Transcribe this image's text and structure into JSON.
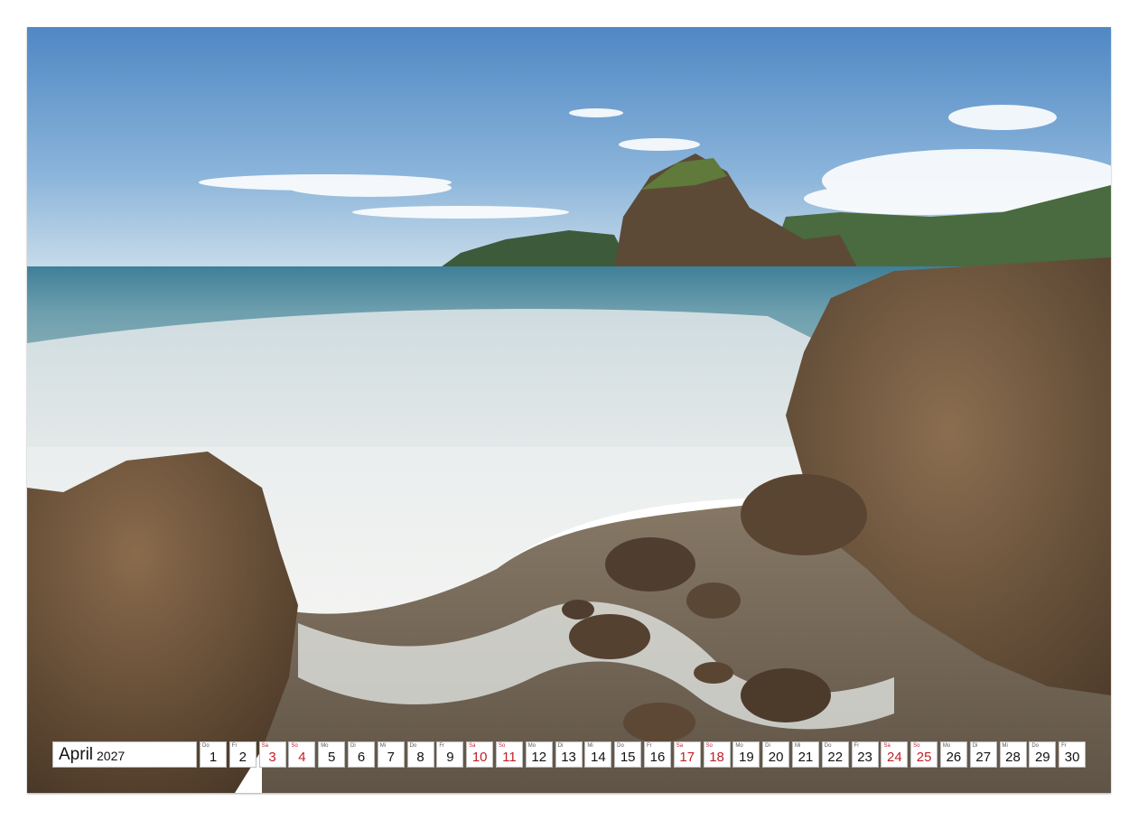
{
  "calendar": {
    "month": "April",
    "year": "2027",
    "weekend_color": "#c0202a",
    "days": [
      {
        "wd": "Do",
        "d": "1",
        "weekend": false
      },
      {
        "wd": "Fr",
        "d": "2",
        "weekend": false
      },
      {
        "wd": "Sa",
        "d": "3",
        "weekend": true
      },
      {
        "wd": "So",
        "d": "4",
        "weekend": true
      },
      {
        "wd": "Mo",
        "d": "5",
        "weekend": false
      },
      {
        "wd": "Di",
        "d": "6",
        "weekend": false
      },
      {
        "wd": "Mi",
        "d": "7",
        "weekend": false
      },
      {
        "wd": "Do",
        "d": "8",
        "weekend": false
      },
      {
        "wd": "Fr",
        "d": "9",
        "weekend": false
      },
      {
        "wd": "Sa",
        "d": "10",
        "weekend": true
      },
      {
        "wd": "So",
        "d": "11",
        "weekend": true
      },
      {
        "wd": "Mo",
        "d": "12",
        "weekend": false
      },
      {
        "wd": "Di",
        "d": "13",
        "weekend": false
      },
      {
        "wd": "Mi",
        "d": "14",
        "weekend": false
      },
      {
        "wd": "Do",
        "d": "15",
        "weekend": false
      },
      {
        "wd": "Fr",
        "d": "16",
        "weekend": false
      },
      {
        "wd": "Sa",
        "d": "17",
        "weekend": true
      },
      {
        "wd": "So",
        "d": "18",
        "weekend": true
      },
      {
        "wd": "Mo",
        "d": "19",
        "weekend": false
      },
      {
        "wd": "Di",
        "d": "20",
        "weekend": false
      },
      {
        "wd": "Mi",
        "d": "21",
        "weekend": false
      },
      {
        "wd": "Do",
        "d": "22",
        "weekend": false
      },
      {
        "wd": "Fr",
        "d": "23",
        "weekend": false
      },
      {
        "wd": "Sa",
        "d": "24",
        "weekend": true
      },
      {
        "wd": "So",
        "d": "25",
        "weekend": true
      },
      {
        "wd": "Mo",
        "d": "26",
        "weekend": false
      },
      {
        "wd": "Di",
        "d": "27",
        "weekend": false
      },
      {
        "wd": "Mi",
        "d": "28",
        "weekend": false
      },
      {
        "wd": "Do",
        "d": "29",
        "weekend": false
      },
      {
        "wd": "Fr",
        "d": "30",
        "weekend": false
      }
    ]
  }
}
